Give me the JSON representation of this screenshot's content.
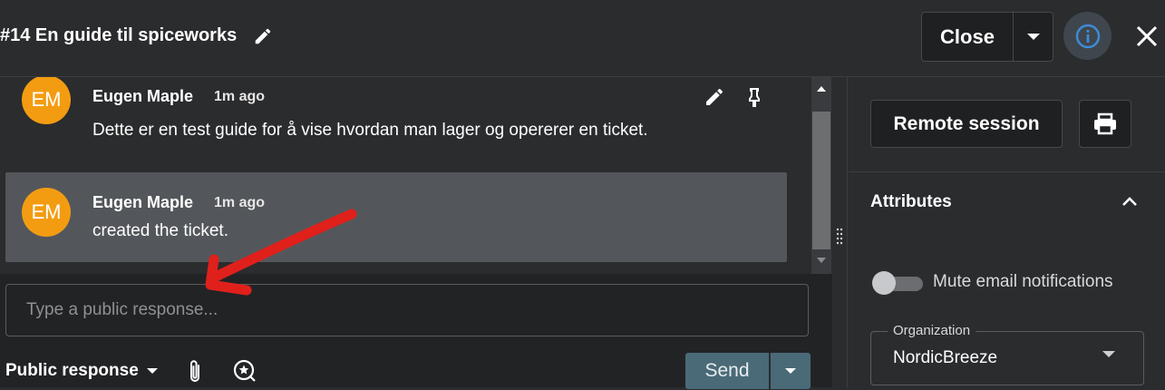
{
  "header": {
    "title": "#14 En guide til spiceworks",
    "close_label": "Close"
  },
  "messages": [
    {
      "initials": "EM",
      "author": "Eugen Maple",
      "time": "1m ago",
      "text": "Dette er en test guide for å vise hvordan man lager og opererer en ticket."
    },
    {
      "initials": "EM",
      "author": "Eugen Maple",
      "time": "1m ago",
      "text": "created the ticket."
    }
  ],
  "composer": {
    "placeholder": "Type a public response...",
    "response_type": "Public response",
    "send_label": "Send"
  },
  "sidebar": {
    "remote_label": "Remote session",
    "attributes_title": "Attributes",
    "mute_label": "Mute email notifications",
    "mute_on": false,
    "org_label": "Organization",
    "org_value": "NordicBreeze"
  },
  "colors": {
    "avatar": "#f39c12",
    "annotation_arrow": "#e0201b",
    "send_button": "#4a6a78",
    "info_icon": "#3d8bd6"
  }
}
